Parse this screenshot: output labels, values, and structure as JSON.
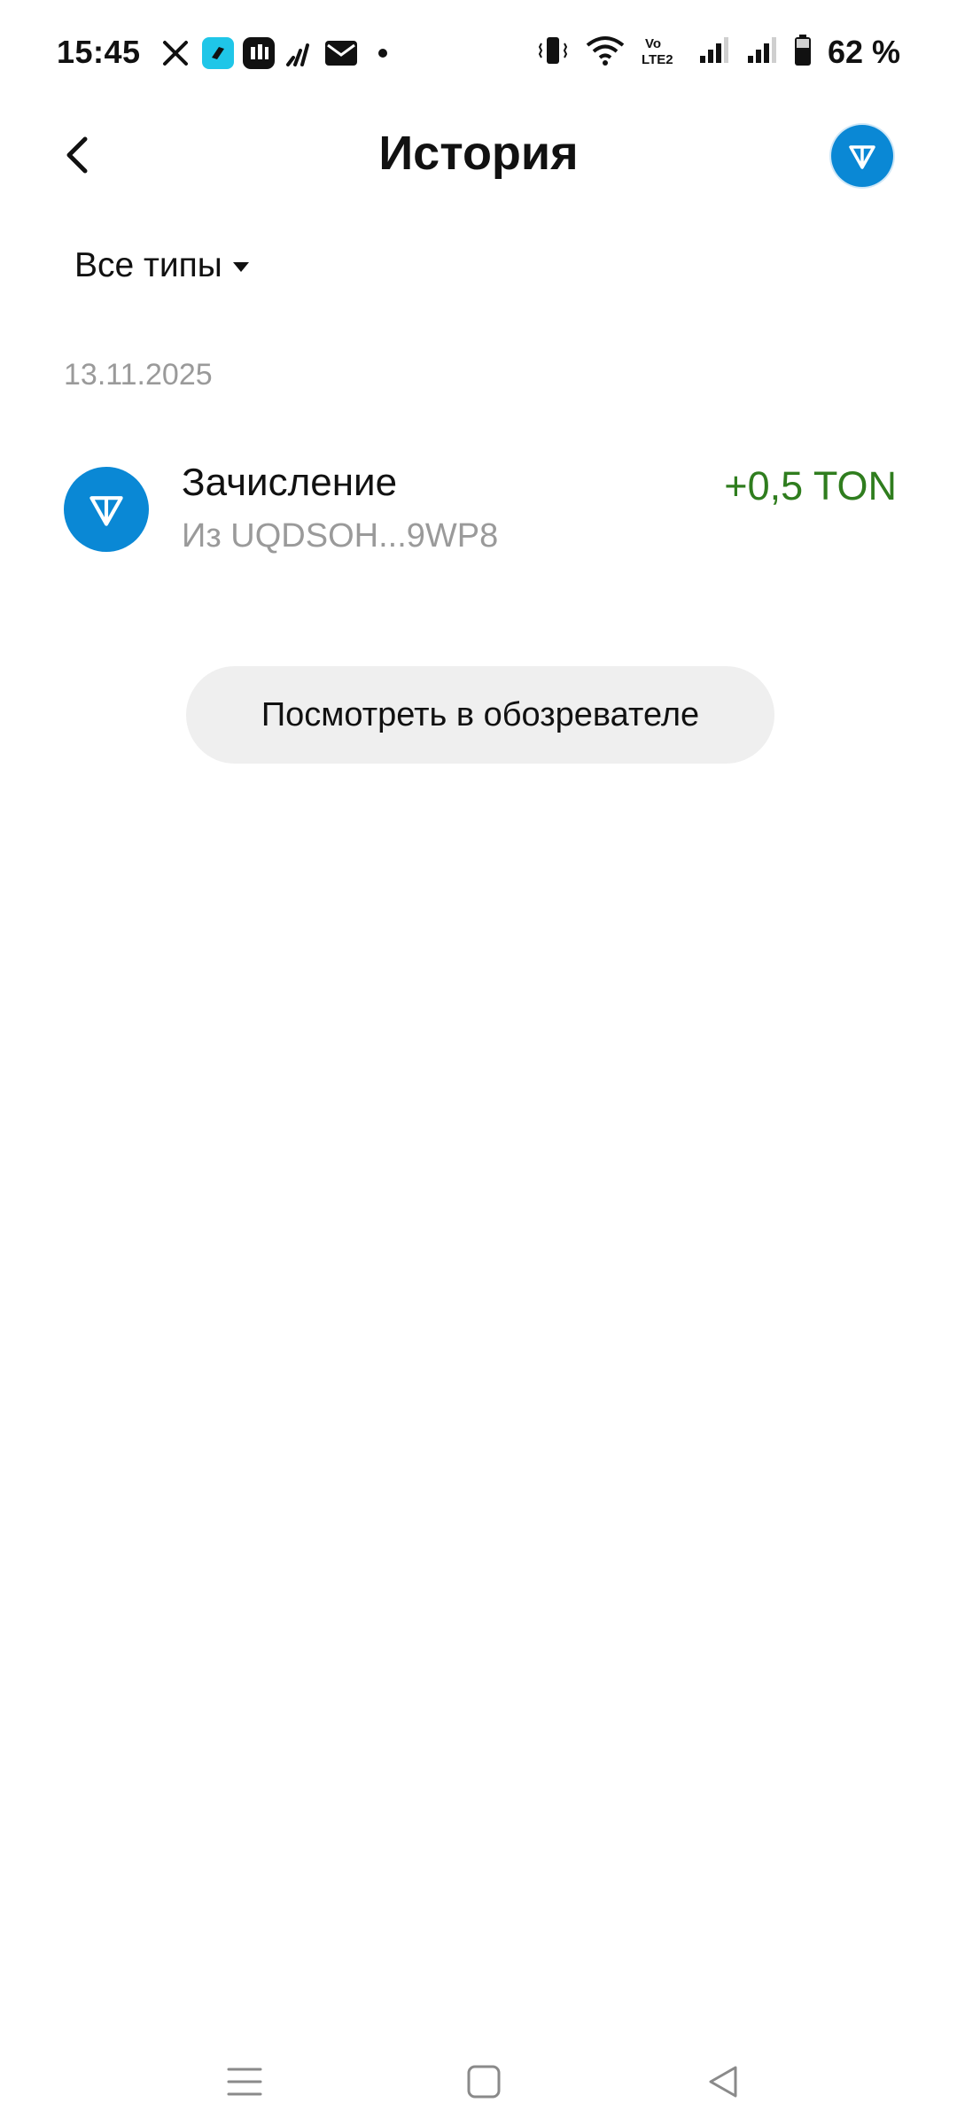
{
  "status_bar": {
    "time": "15:45",
    "battery_percent": "62 %",
    "left_icons": [
      "x-icon",
      "app-icon",
      "mi-app-icon",
      "signal-app-icon",
      "mail-icon",
      "dot-icon"
    ],
    "right_icons": [
      "vibrate-icon",
      "wifi-icon",
      "volte-icon",
      "signal-icon",
      "signal-icon",
      "battery-icon"
    ],
    "volte_text": "Vo LTE2"
  },
  "header": {
    "title": "История"
  },
  "filter": {
    "label": "Все типы"
  },
  "history": {
    "date": "13.11.2025",
    "transactions": [
      {
        "title": "Зачисление",
        "subtitle": "Из UQDSOH...9WP8",
        "amount": "+0,5 TON",
        "amount_color": "#2f7d1e",
        "icon": "ton-icon"
      }
    ]
  },
  "explorer_button": {
    "label": "Посмотреть в обозревателе"
  },
  "colors": {
    "ton_blue": "#0a88d5",
    "muted_text": "#9a9a9a",
    "button_bg": "#efefef"
  },
  "nav_bar": {
    "icons": [
      "menu-icon",
      "home-square-icon",
      "back-triangle-icon"
    ]
  }
}
